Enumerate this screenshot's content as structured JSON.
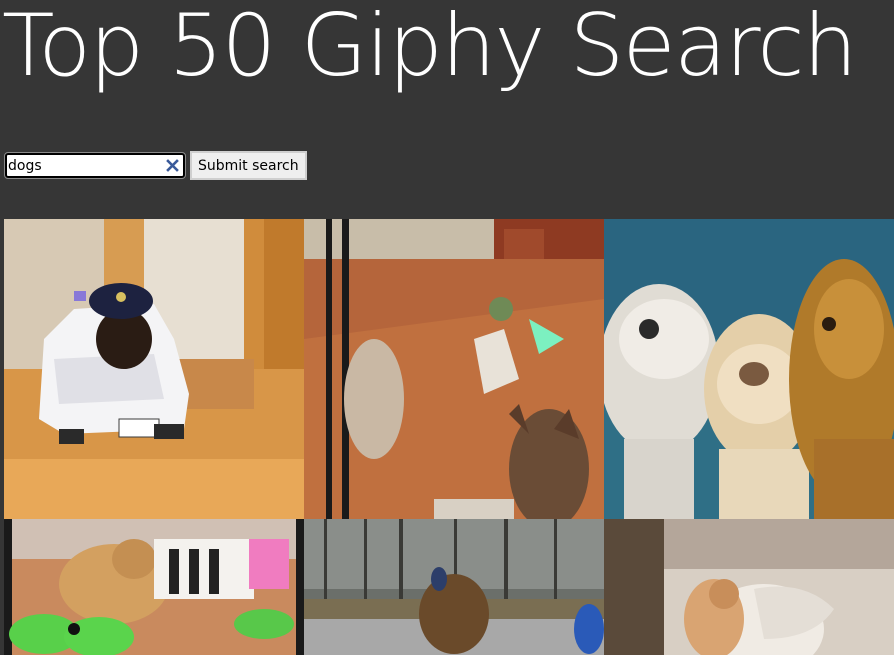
{
  "header": {
    "title": "Top 50 Giphy Search"
  },
  "search": {
    "value": "dogs",
    "clear_icon": "clear-x-icon"
  },
  "submit": {
    "label": "Submit search"
  },
  "results": [
    {
      "name": "gif-dog-police-car"
    },
    {
      "name": "gif-dog-yoda-costume"
    },
    {
      "name": "gif-three-dogs-clapping"
    },
    {
      "name": "gif-golden-retriever-toys"
    },
    {
      "name": "gif-german-shepherd-woods"
    },
    {
      "name": "gif-puppy-blanket"
    }
  ]
}
